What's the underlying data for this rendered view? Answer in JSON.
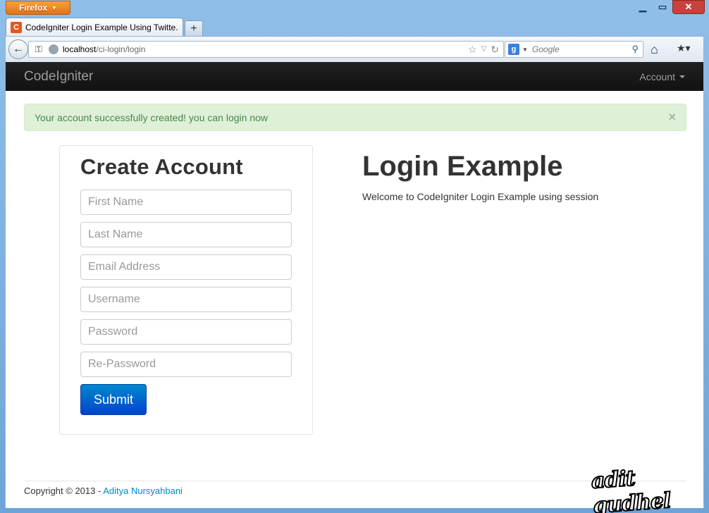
{
  "browser": {
    "menu_button": "Firefox",
    "tab_title": "CodeIgniter Login Example Using Twitte...",
    "new_tab": "+",
    "url_host": "localhost",
    "url_path": "/ci-login/login",
    "search_engine": "Google",
    "search_placeholder": "Google"
  },
  "site": {
    "brand": "CodeIgniter",
    "account_menu": "Account",
    "alert_text": "Your account successfully created! you can login now",
    "alert_close": "×"
  },
  "form": {
    "title": "Create Account",
    "fields": [
      {
        "placeholder": "First Name"
      },
      {
        "placeholder": "Last Name"
      },
      {
        "placeholder": "Email Address"
      },
      {
        "placeholder": "Username"
      },
      {
        "placeholder": "Password"
      },
      {
        "placeholder": "Re-Password"
      }
    ],
    "submit_label": "Submit"
  },
  "intro": {
    "title": "Login Example",
    "text": "Welcome to CodeIgniter Login Example using session"
  },
  "footer": {
    "copyright": "Copyright © 2013 - ",
    "author": "Aditya Nursyahbani"
  },
  "watermark": "adit gudhel",
  "colors": {
    "navbar_bg": "#111111",
    "alert_bg": "#dff0d8",
    "alert_text": "#468847",
    "primary": "#0088cc"
  }
}
